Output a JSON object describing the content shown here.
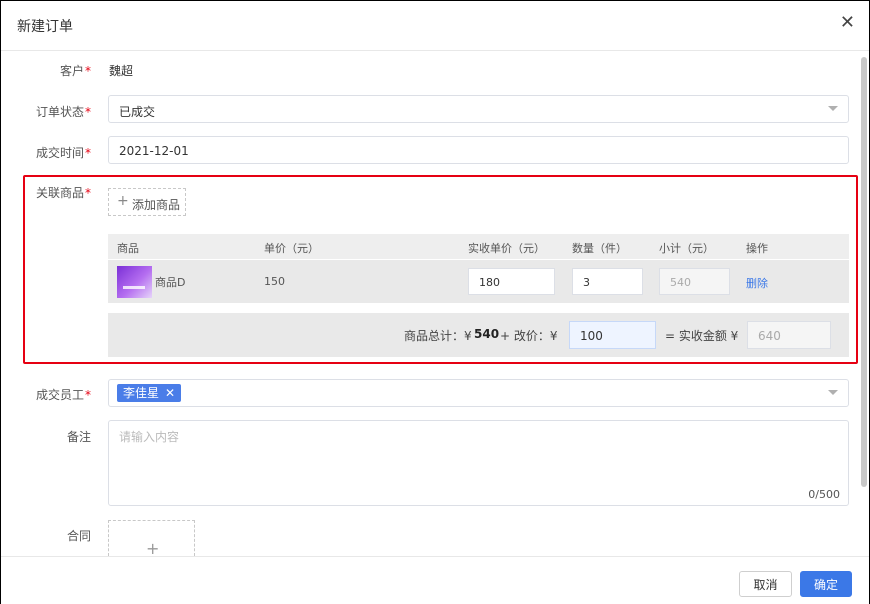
{
  "dialog": {
    "title": "新建订单"
  },
  "form": {
    "customer": {
      "label": "客户",
      "value": "魏超"
    },
    "order_status": {
      "label": "订单状态",
      "value": "已成交"
    },
    "deal_time": {
      "label": "成交时间",
      "value": "2021-12-01"
    },
    "products": {
      "label": "关联商品",
      "add_label": "添加商品",
      "columns": [
        "商品",
        "单价（元）",
        "实收单价（元）",
        "数量（件）",
        "小计（元）",
        "操作"
      ],
      "rows": [
        {
          "name": "商品D",
          "price": "150",
          "actual_price": "180",
          "quantity": "3",
          "subtotal": "540",
          "action": "删除"
        }
      ],
      "summary": {
        "total_label": "商品总计：¥",
        "total_value": "540",
        "adjust_label": "+ 改价：¥",
        "adjust_value": "100",
        "actual_label": "= 实收金额 ¥",
        "actual_value": "640"
      }
    },
    "staff": {
      "label": "成交员工",
      "tag": "李佳星"
    },
    "remark": {
      "label": "备注",
      "placeholder": "请输入内容",
      "counter": "0/500"
    },
    "contract": {
      "label": "合同"
    }
  },
  "footer": {
    "cancel": "取消",
    "ok": "确定"
  },
  "colors": {
    "primary": "#3b78e7",
    "required": "#e60012",
    "highlight_box": "#e60012"
  }
}
